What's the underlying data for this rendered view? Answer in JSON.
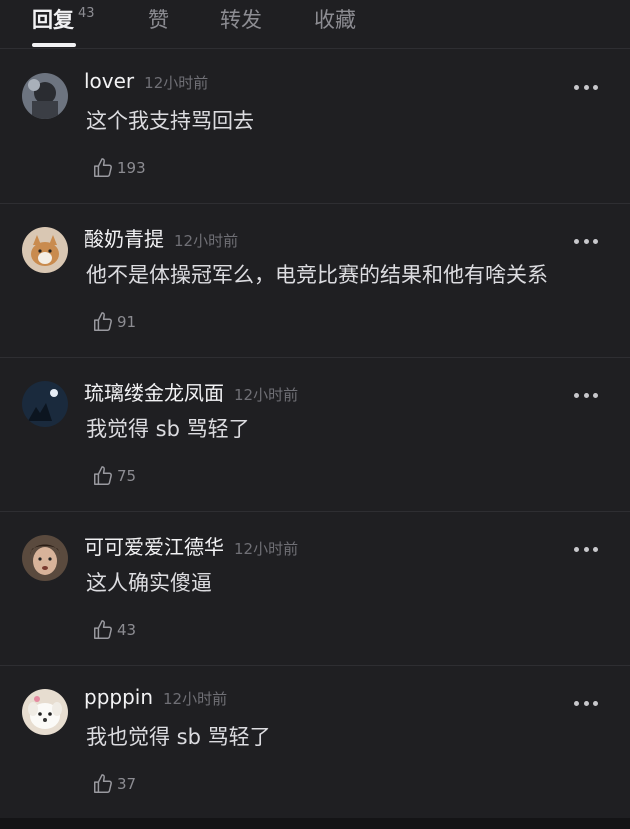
{
  "tabs": [
    {
      "label": "回复",
      "count": "43",
      "active": true
    },
    {
      "label": "赞"
    },
    {
      "label": "转发"
    },
    {
      "label": "收藏"
    }
  ],
  "comments": [
    {
      "username": "lover",
      "time": "12小时前",
      "text": "这个我支持骂回去",
      "likes": "193",
      "avatar": "avatar-dark-figure"
    },
    {
      "username": "酸奶青提",
      "time": "12小时前",
      "text": "他不是体操冠军么，电竞比赛的结果和他有啥关系",
      "likes": "91",
      "avatar": "avatar-cat"
    },
    {
      "username": "琉璃缕金龙凤面",
      "time": "12小时前",
      "text": "我觉得 sb 骂轻了",
      "likes": "75",
      "avatar": "avatar-night-moon"
    },
    {
      "username": "可可爱爱江德华",
      "time": "12小时前",
      "text": "这人确实傻逼",
      "likes": "43",
      "avatar": "avatar-person"
    },
    {
      "username": "ppppin",
      "time": "12小时前",
      "text": "我也觉得 sb 骂轻了",
      "likes": "37",
      "avatar": "avatar-white-dog"
    }
  ],
  "colors": {
    "background": "#1f1f22",
    "divider": "#2e2e32",
    "text_primary": "#f2f2f4",
    "text_secondary": "#8c8c92"
  }
}
